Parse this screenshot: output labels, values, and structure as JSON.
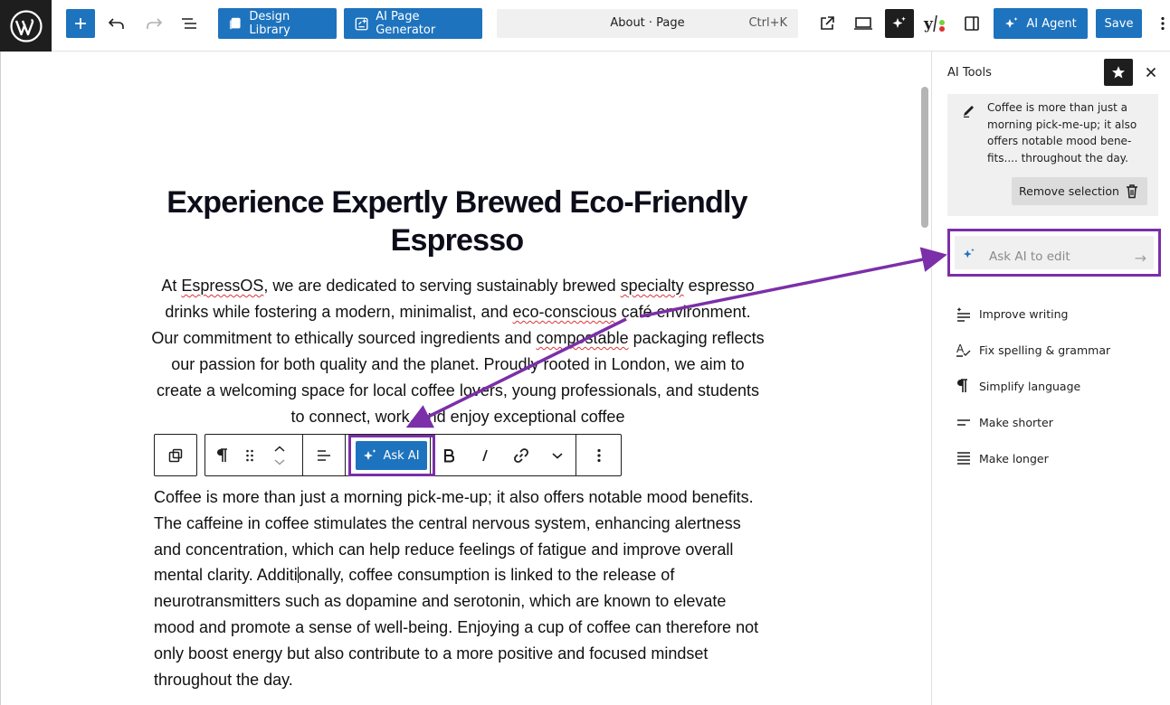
{
  "topbar": {
    "design_library": "Design Library",
    "ai_page_generator": "AI Page Generator",
    "command_title": "About · Page",
    "command_shortcut": "Ctrl+K",
    "ai_agent": "AI Agent",
    "save": "Save"
  },
  "editor": {
    "heading": "Experience Expertly Brewed Eco-Friendly Espresso",
    "intro": "At EspressOS, we are dedicated to serving sustainably brewed specialty espresso drinks while fostering a modern, minimalist, and eco-conscious café environment. Our commitment to ethically sourced ingredients and compostable packaging reflects our passion for both quality and the planet. Proudly rooted in London, we aim to create a welcoming space for local coffee lovers, young professionals, and students to connect, work, and enjoy exceptional coffee",
    "coffee_before_caret": "Coffee is more than just a morning pick-me-up; it also offers notable mood benefits. The caffeine in coffee stimulates the central nervous system, enhancing alertness and concentration, which can help reduce feelings of fatigue and improve overall mental clarity. Additi",
    "coffee_after_caret": "onally, coffee consumption is linked to the release of neurotransmitters such as dopamine and serotonin, which are known to elevate mood and promote a sense of well-being. Enjoying a cup of coffee can therefore not only boost energy but also contribute to a more positive and focused mindset throughout the day.",
    "toolbar": {
      "ask_ai": "Ask AI"
    }
  },
  "sidebar": {
    "title": "AI Tools",
    "selection_text": "Coffee is more than just a morning pick-me-up; it also offers notable mood bene-fits.... throughout the day.",
    "remove_selection": "Remove selection",
    "ask_placeholder": "Ask AI to edit",
    "tools": [
      {
        "label": "Improve writing",
        "icon": "improve-writing-icon"
      },
      {
        "label": "Fix spelling & grammar",
        "icon": "spelling-icon"
      },
      {
        "label": "Simplify language",
        "icon": "pilcrow-icon"
      },
      {
        "label": "Make shorter",
        "icon": "shorter-icon"
      },
      {
        "label": "Make longer",
        "icon": "longer-icon"
      }
    ]
  },
  "colors": {
    "accent_blue": "#1e73be",
    "highlight_purple": "#7b2fa8",
    "dark": "#1e1e1e"
  }
}
